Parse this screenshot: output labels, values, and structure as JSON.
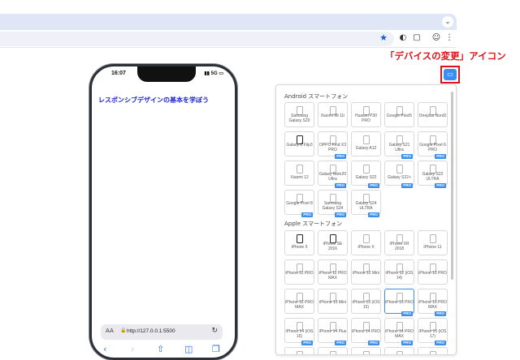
{
  "browser": {
    "tab_dropdown_icon": "chevron-down-icon",
    "toolbar_icons": [
      "star-icon",
      "extension-icon",
      "puzzle-icon",
      "profile-icon",
      "menu-icon"
    ]
  },
  "annotation": {
    "label": "「デバイスの変更」アイコン",
    "color": "#e0141b",
    "icon": "device-switch-icon"
  },
  "phone": {
    "time": "16:07",
    "status": "5G",
    "heading": "レスポンシブデザインの基本を学ぼう",
    "url": "http://127.0.0.1:5500",
    "aa": "AA"
  },
  "panel": {
    "android_title": "Android スマートフォン",
    "apple_title": "Apple スマートフォン",
    "android_devices": [
      {
        "label": "Samsung Galaxy S20"
      },
      {
        "label": "Xiaomi Mi 11i"
      },
      {
        "label": "Huawei P30 PRO"
      },
      {
        "label": "Google Pixel5"
      },
      {
        "label": "Oneplus Nord2"
      },
      {
        "label": "Galaxy Z Flip3"
      },
      {
        "label": "OPPO Find X3 PRO",
        "badge": "PRO"
      },
      {
        "label": "Galaxy A12"
      },
      {
        "label": "Galaxy S21 Ultra",
        "badge": "PRO"
      },
      {
        "label": "Google Pixel 6 PRO",
        "badge": "PRO"
      },
      {
        "label": "Xiaomi 12"
      },
      {
        "label": "Galaxy Note20 Ultra",
        "badge": "PRO"
      },
      {
        "label": "Galaxy S22",
        "badge": "PRO"
      },
      {
        "label": "Galaxy S22+",
        "badge": "PRO"
      },
      {
        "label": "Galaxy S22 ULTRA",
        "badge": "PRO"
      },
      {
        "label": "Google Pixel 8",
        "badge": "PRO"
      },
      {
        "label": "Samsung Galaxy S24",
        "badge": "PRO"
      },
      {
        "label": "Galaxy S24 ULTRA",
        "badge": "PRO"
      }
    ],
    "apple_devices": [
      {
        "label": "iPhone 5"
      },
      {
        "label": "iPhone SE 2016"
      },
      {
        "label": "iPhone X"
      },
      {
        "label": "iPhone XR 2018"
      },
      {
        "label": "iPhone 11"
      },
      {
        "label": "iPhone 11 PRO"
      },
      {
        "label": "iPhone 11 PRO MAX"
      },
      {
        "label": "iPhone 12 Mini"
      },
      {
        "label": "iPhone 12 (iOS 14)"
      },
      {
        "label": "iPhone 12 PRO"
      },
      {
        "label": "iPhone 12 PRO MAX"
      },
      {
        "label": "iPhone 13 Mini"
      },
      {
        "label": "iPhone 13 (iOS 15)"
      },
      {
        "label": "iPhone 13 PRO",
        "selected": true,
        "badge": "PRO"
      },
      {
        "label": "iPhone 13 PRO MAX",
        "badge": "PRO"
      },
      {
        "label": "iPhone 14 (iOS 16)",
        "badge": "PRO"
      },
      {
        "label": "iPhone 14 Plus",
        "badge": "PRO"
      },
      {
        "label": "iPhone 14 PRO",
        "badge": "PRO"
      },
      {
        "label": "iPhone 14 PRO MAX",
        "badge": "PRO"
      },
      {
        "label": "iPhone 15 (iOS 17)",
        "badge": "PRO"
      },
      {
        "label": "",
        "badge": "PRO"
      },
      {
        "label": "",
        "badge": "PRO"
      },
      {
        "label": "",
        "badge": "PRO"
      },
      {
        "label": "",
        "badge": "PRO"
      },
      {
        "label": "",
        "badge": "PRO"
      }
    ]
  }
}
